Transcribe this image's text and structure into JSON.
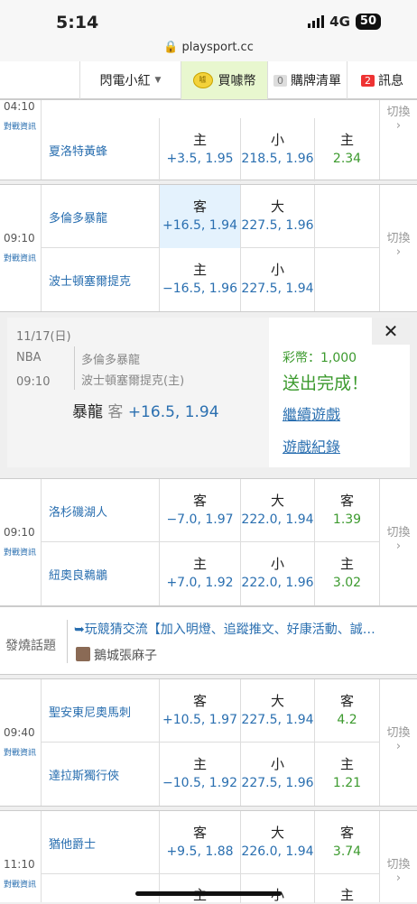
{
  "status_bar": {
    "time": "5:14",
    "network": "4G",
    "battery": "50"
  },
  "browser": {
    "url": "playsport.cc"
  },
  "nav": {
    "user": "閃電小紅",
    "buy_coin": "買噱幣",
    "coin_icon": "噱",
    "cart_count": "0",
    "cart": "購牌清單",
    "msg_count": "2",
    "messages": "訊息"
  },
  "common": {
    "switch": "切換",
    "match_info": "對戰資訊"
  },
  "games": [
    {
      "time": "04:10",
      "away": null,
      "home": {
        "team": "夏洛特黃蜂",
        "spread_k": "主",
        "spread": "+3.5, 1.95",
        "total_k": "小",
        "total": "218.5, 1.96",
        "ml_k": "主",
        "ml": "2.34"
      }
    },
    {
      "time": "09:10",
      "away": {
        "team": "多倫多暴龍",
        "spread_k": "客",
        "spread": "+16.5, 1.94",
        "total_k": "大",
        "total": "227.5, 1.96",
        "ml_k": "",
        "ml": ""
      },
      "home": {
        "team": "波士頓塞爾提克",
        "spread_k": "主",
        "spread": "−16.5, 1.96",
        "total_k": "小",
        "total": "227.5, 1.94",
        "ml_k": "",
        "ml": ""
      }
    },
    {
      "time": "09:10",
      "away": {
        "team": "洛杉磯湖人",
        "spread_k": "客",
        "spread": "−7.0, 1.97",
        "total_k": "大",
        "total": "222.0, 1.94",
        "ml_k": "客",
        "ml": "1.39"
      },
      "home": {
        "team": "紐奧良鵜鶘",
        "spread_k": "主",
        "spread": "+7.0, 1.92",
        "total_k": "小",
        "total": "222.0, 1.96",
        "ml_k": "主",
        "ml": "3.02"
      }
    },
    {
      "time": "09:40",
      "away": {
        "team": "聖安東尼奧馬刺",
        "spread_k": "客",
        "spread": "+10.5, 1.97",
        "total_k": "大",
        "total": "227.5, 1.94",
        "ml_k": "客",
        "ml": "4.2"
      },
      "home": {
        "team": "達拉斯獨行俠",
        "spread_k": "主",
        "spread": "−10.5, 1.92",
        "total_k": "小",
        "total": "227.5, 1.96",
        "ml_k": "主",
        "ml": "1.21"
      }
    },
    {
      "time": "11:10",
      "away": {
        "team": "猶他爵士",
        "spread_k": "客",
        "spread": "+9.5, 1.88",
        "total_k": "大",
        "total": "226.0, 1.94",
        "ml_k": "客",
        "ml": "3.74"
      },
      "home": {
        "team": "",
        "spread_k": "主",
        "spread": "",
        "total_k": "小",
        "total": "",
        "ml_k": "主",
        "ml": ""
      }
    }
  ],
  "popup": {
    "date": "11/17(日)",
    "league": "NBA",
    "time": "09:10",
    "team1": "多倫多暴龍",
    "team2": "波士頓塞爾提克(主)",
    "pick_team": "暴龍",
    "pick_side": "客",
    "pick_odds": "+16.5, 1.94",
    "coins": "彩幣：1,000",
    "result": "送出完成！",
    "continue": "繼續遊戲",
    "history": "遊戲紀錄",
    "close": "✕"
  },
  "hot_topic": {
    "label": "發燒話題",
    "title": "➥玩競猜交流【加入明燈、追蹤推文、好康活動、誠…",
    "author": "鵝城張麻子"
  }
}
